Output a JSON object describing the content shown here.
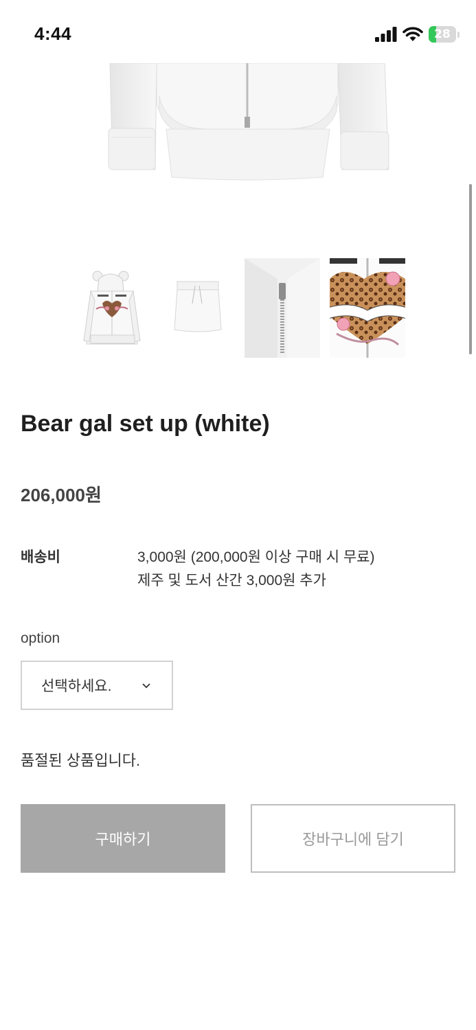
{
  "status_bar": {
    "time": "4:44",
    "battery": "28"
  },
  "product": {
    "name": "Bear gal set up (white)",
    "price": "206,000원",
    "thumbnails": [
      {
        "icon": "hoodie-front-thumbnail",
        "print_text": "Metal Angel"
      },
      {
        "icon": "skirt-thumbnail"
      },
      {
        "icon": "zipper-detail-thumbnail"
      },
      {
        "icon": "heart-print-detail-thumbnail",
        "print_text": "Metal Angel"
      }
    ]
  },
  "shipping": {
    "label": "배송비",
    "line1": "3,000원 (200,000원 이상 구매 시 무료)",
    "line2": "제주 및 도서 산간 3,000원 추가"
  },
  "option": {
    "label": "option",
    "selected": "선택하세요."
  },
  "soldout_message": "품절된 상품입니다.",
  "actions": {
    "buy_label": "구매하기",
    "cart_label": "장바구니에 담기"
  },
  "colors": {
    "buy_button_bg": "#a7a7a7",
    "battery_green": "#34c759"
  }
}
